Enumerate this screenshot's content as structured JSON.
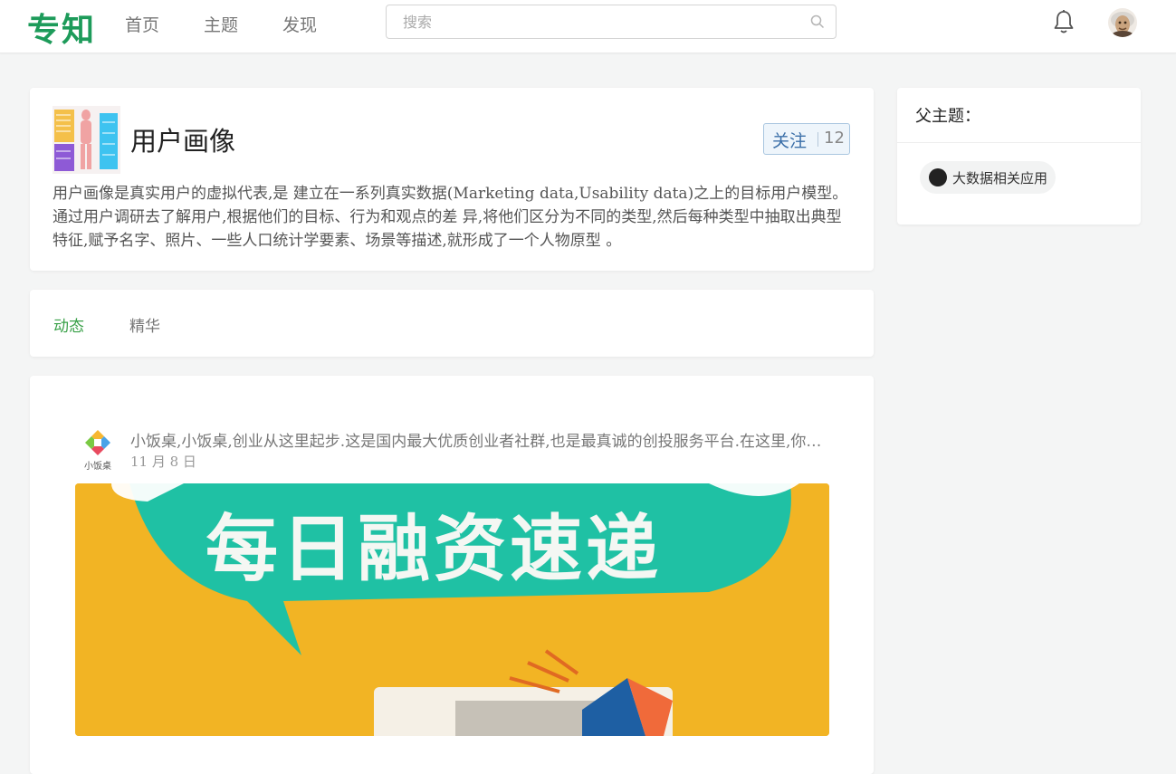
{
  "header": {
    "logo": "专知",
    "nav": [
      "首页",
      "主题",
      "发现"
    ],
    "search_placeholder": "搜索"
  },
  "topic": {
    "title": "用户画像",
    "follow_label": "关注",
    "follow_count": "12",
    "description": "用户画像是真实用户的虚拟代表,是 建立在一系列真实数据(Marketing data,Usability data)之上的目标用户模型。通过用户调研去了解用户,根据他们的目标、行为和观点的差 异,将他们区分为不同的类型,然后每种类型中抽取出典型特征,赋予名字、照片、一些人口统计学要素、场景等描述,就形成了一个人物原型 。"
  },
  "tabs": [
    "动态",
    "精华"
  ],
  "feed": {
    "source_logo_text": "小饭桌",
    "source_name": "小饭桌,小饭桌,创业从这里起步.这是国内最大优质创业者社群,也是最真诚的创投服务平台.在这里,你可以找到",
    "date": "11 月 8 日",
    "cover_text": "每日融资速递"
  },
  "sidebar": {
    "parent_title": "父主题：",
    "parent_tag": "大数据相关应用"
  },
  "colors": {
    "brand_green": "#1d9b5a",
    "tab_active": "#3aa149",
    "follow_blue": "#3b6fa8",
    "cover_yellow": "#f2b424",
    "cover_teal": "#1fc1a4"
  }
}
